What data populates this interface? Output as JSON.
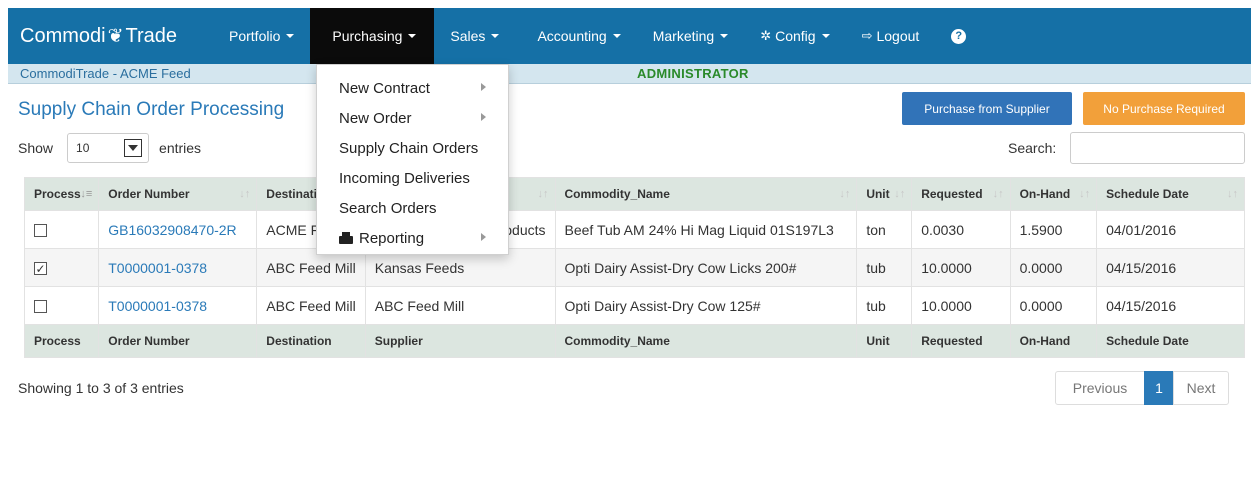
{
  "navbar": {
    "brand_left": "Commodi",
    "brand_glyph": "❦",
    "brand_right": "Trade",
    "items": [
      {
        "label": "Portfolio"
      },
      {
        "label": "Purchasing"
      },
      {
        "label": "Sales"
      },
      {
        "label": "Accounting"
      },
      {
        "label": "Marketing"
      },
      {
        "label": "Config"
      },
      {
        "label": "Logout"
      }
    ],
    "help": "?",
    "colors": {
      "bar": "#1570a6",
      "active": "#0b0b0b"
    }
  },
  "subbar": {
    "company": "CommodiTrade - ACME Feed",
    "role": "ADMINISTRATOR"
  },
  "page": {
    "title": "Supply Chain Order Processing",
    "buttons": {
      "purchase": "Purchase from Supplier",
      "no_purchase": "No Purchase Required"
    },
    "show_label": "Show",
    "entries_value": "10",
    "entries_label": "entries",
    "search_label": "Search:",
    "search_value": ""
  },
  "purchasing_menu": [
    {
      "label": "New Contract",
      "submenu": true
    },
    {
      "label": "New Order",
      "submenu": true
    },
    {
      "label": "Supply Chain Orders",
      "submenu": false
    },
    {
      "label": "Incoming Deliveries",
      "submenu": false
    },
    {
      "label": "Search Orders",
      "submenu": false
    },
    {
      "label": "Reporting",
      "submenu": true,
      "icon": "print-icon"
    }
  ],
  "table": {
    "columns": [
      "Process",
      "Order Number",
      "Destination",
      "Supplier",
      "Commodity_Name",
      "Unit",
      "Requested",
      "On-Hand",
      "Schedule Date"
    ],
    "header_visible": [
      "Process",
      "Order Number",
      "Destinati",
      "",
      "Commodity_Name",
      "Unit",
      "Requested",
      "On-Hand",
      "Schedule Date"
    ],
    "rows": [
      {
        "checked": false,
        "order": "GB16032908470-2R",
        "destination": "ACME F",
        "supplier": "oducts",
        "commodity": "Beef Tub AM 24% Hi Mag Liquid 01S197L3",
        "unit": "ton",
        "requested": "0.0030",
        "onhand": "1.5900",
        "date": "04/01/2016"
      },
      {
        "checked": true,
        "order": "T0000001-0378",
        "destination": "ABC Feed Mill",
        "supplier": "Kansas Feeds",
        "commodity": "Opti Dairy Assist-Dry Cow Licks 200#",
        "unit": "tub",
        "requested": "10.0000",
        "onhand": "0.0000",
        "date": "04/15/2016"
      },
      {
        "checked": false,
        "order": "T0000001-0378",
        "destination": "ABC Feed Mill",
        "supplier": "ABC Feed Mill",
        "commodity": "Opti Dairy Assist-Dry Cow 125#",
        "unit": "tub",
        "requested": "10.0000",
        "onhand": "0.0000",
        "date": "04/15/2016"
      }
    ]
  },
  "footer": {
    "info": "Showing 1 to 3 of 3 entries",
    "prev": "Previous",
    "page": "1",
    "next": "Next"
  }
}
